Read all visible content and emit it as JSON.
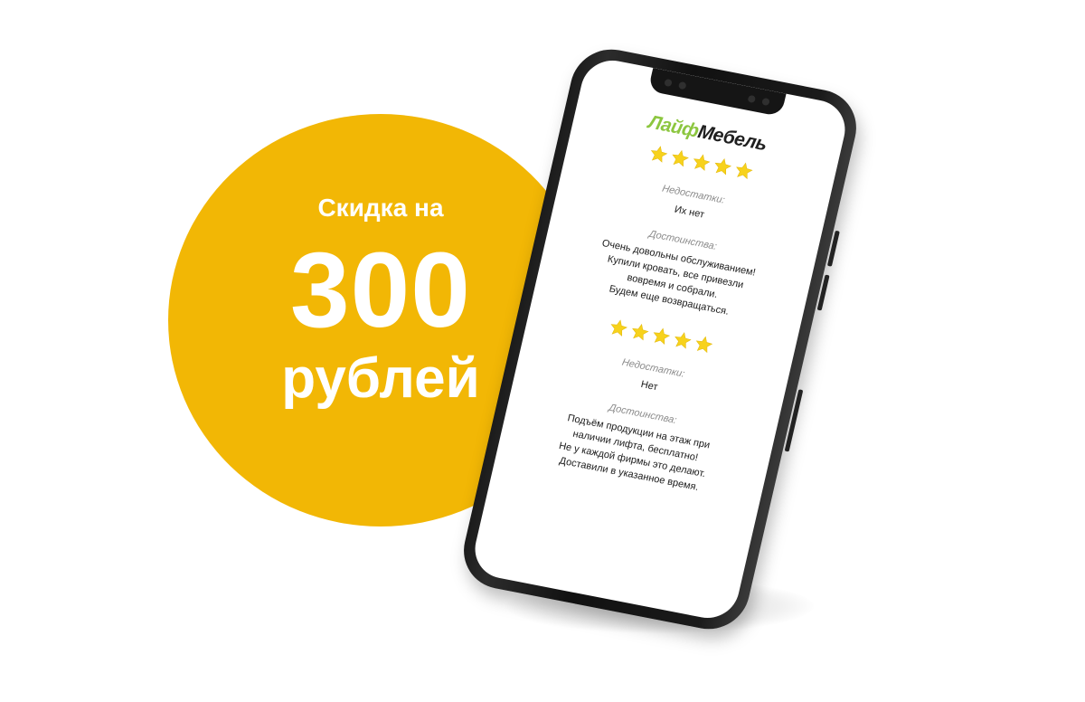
{
  "promo": {
    "line1": "Скидка на",
    "line2": "300",
    "line3": "рублей",
    "circle_color": "#f2b705",
    "text_color": "#ffffff"
  },
  "phone": {
    "logo": {
      "part_a": "Лайф",
      "part_b": "Мебель",
      "color_a": "#8cc63f",
      "color_b": "#1f1f1f"
    },
    "reviews": [
      {
        "rating": 5,
        "cons_label": "Недостатки:",
        "cons_text": "Их нет",
        "pros_label": "Достоинства:",
        "pros_lines": [
          "Очень довольны обслуживанием!",
          "Купили кровать, все привезли",
          "вовремя и собрали.",
          "Будем еще возвращаться."
        ]
      },
      {
        "rating": 5,
        "cons_label": "Недостатки:",
        "cons_text": "Нет",
        "pros_label": "Достоинства:",
        "pros_lines": [
          "Подъём продукции на этаж при",
          "наличии лифта, бесплатно!",
          "Не у каждой фирмы это делают.",
          "Доставили в указанное время."
        ]
      }
    ],
    "star_color": "#f7d21c",
    "star_icon": "star-icon"
  }
}
